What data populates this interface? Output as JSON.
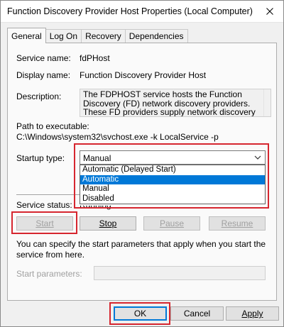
{
  "window": {
    "title": "Function Discovery Provider Host Properties (Local Computer)"
  },
  "tabs": [
    {
      "label": "General",
      "active": true
    },
    {
      "label": "Log On",
      "active": false
    },
    {
      "label": "Recovery",
      "active": false
    },
    {
      "label": "Dependencies",
      "active": false
    }
  ],
  "general": {
    "service_name_label": "Service name:",
    "service_name_value": "fdPHost",
    "display_name_label": "Display name:",
    "display_name_value": "Function Discovery Provider Host",
    "description_label": "Description:",
    "description_value": "The FDPHOST service hosts the Function Discovery (FD) network discovery providers. These FD providers supply network discovery services for",
    "path_label": "Path to executable:",
    "path_value": "C:\\Windows\\system32\\svchost.exe -k LocalService -p",
    "startup_type_label": "Startup type:",
    "startup_type_value": "Manual",
    "startup_options": [
      "Automatic (Delayed Start)",
      "Automatic",
      "Manual",
      "Disabled"
    ],
    "highlighted_option": "Automatic",
    "service_status_label": "Service status:",
    "service_status_value": "Running",
    "buttons": {
      "start": "Start",
      "stop": "Stop",
      "pause": "Pause",
      "resume": "Resume"
    },
    "info_text": "You can specify the start parameters that apply when you start the service from here.",
    "start_params_label": "Start parameters:",
    "start_params_value": ""
  },
  "footer": {
    "ok": "OK",
    "cancel": "Cancel",
    "apply": "Apply"
  },
  "colors": {
    "highlight": "#0078d7",
    "annotation_red": "#d6262f"
  }
}
